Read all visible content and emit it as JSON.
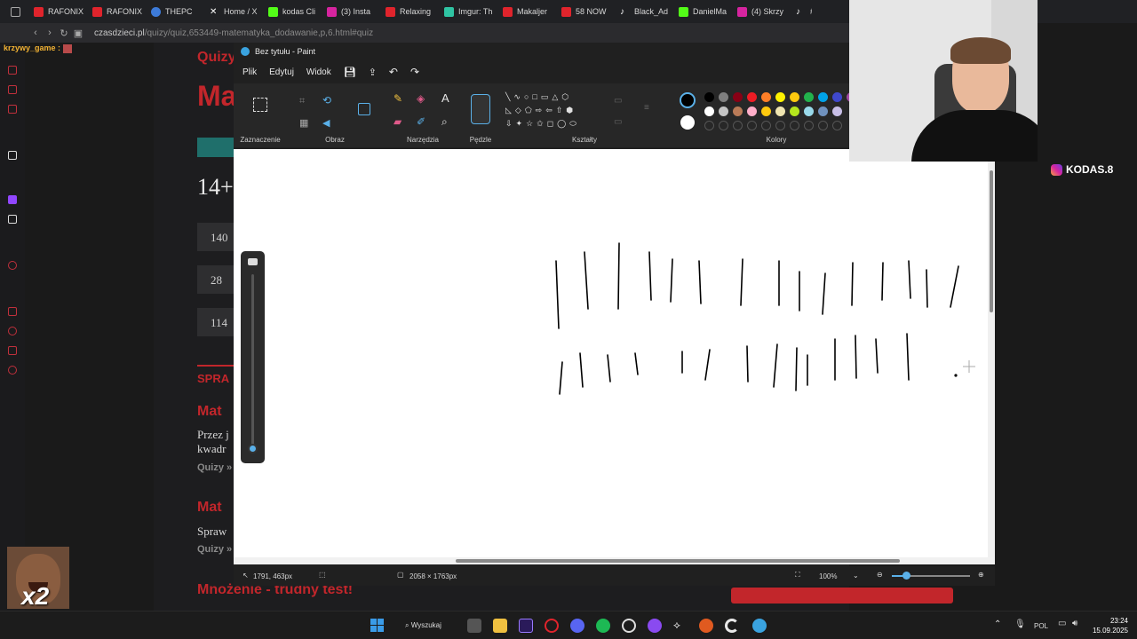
{
  "browser": {
    "tabs": [
      "RAFONIX",
      "RAFONIX",
      "THEPC",
      "Home / X",
      "kodas Cli",
      "(3) Insta",
      "Relaxing",
      "Imgur: Th",
      "Makaljer",
      "58 NOW",
      "Black_Ad",
      "DanielMa",
      "(4) Skrzy",
      "#"
    ],
    "url_host": "czasdzieci.pl",
    "url_path": "/quizy/quiz,653449-matematyka_dodawanie,p,6.html#quiz"
  },
  "stream": {
    "username": "krzywy_game :",
    "instagram_handle": "KODAS.8",
    "emote_label": "x2"
  },
  "site": {
    "quiz_label": "Quizy",
    "heading_fragment": "Ma",
    "problem_fragment": "14+",
    "answers": [
      "140",
      "28",
      "114"
    ],
    "section_label": "SPRA",
    "item1_title": "Mat",
    "item1_line1": "Przez j",
    "item1_line2": "kwadr",
    "item1_quizy": "Quizy »",
    "item2_title": "Mat",
    "item2_line1": "Spraw",
    "item2_quizy": "Quizy »",
    "bottom_link": "Mnożenie - trudny test!"
  },
  "paint": {
    "title": "Bez tytułu - Paint",
    "menu": [
      "Plik",
      "Edytuj",
      "Widok"
    ],
    "groups": {
      "selection": "Zaznaczenie",
      "image": "Obraz",
      "tools": "Narzędzia",
      "brushes": "Pędzle",
      "shapes": "Kształty",
      "colors": "Kolory"
    },
    "palette_row1": [
      "#000000",
      "#7f7f7f",
      "#880015",
      "#ed1c24",
      "#ff7f27",
      "#fff200",
      "#ffc90e",
      "#22b14c",
      "#00a2e8",
      "#3f48cc",
      "#a349a4"
    ],
    "palette_row2": [
      "#ffffff",
      "#c3c3c3",
      "#b97a57",
      "#ffaec9",
      "#ffc90e",
      "#efe4b0",
      "#b5e61d",
      "#99d9ea",
      "#7092be",
      "#c8bfe7"
    ],
    "status": {
      "cursor_pos": "1791, 463px",
      "canvas_size": "2058 × 1763px",
      "zoom": "100%"
    }
  },
  "taskbar": {
    "search_label": "Wyszukaj",
    "language": "POL",
    "time": "23:24",
    "date": "15.09.2025"
  }
}
